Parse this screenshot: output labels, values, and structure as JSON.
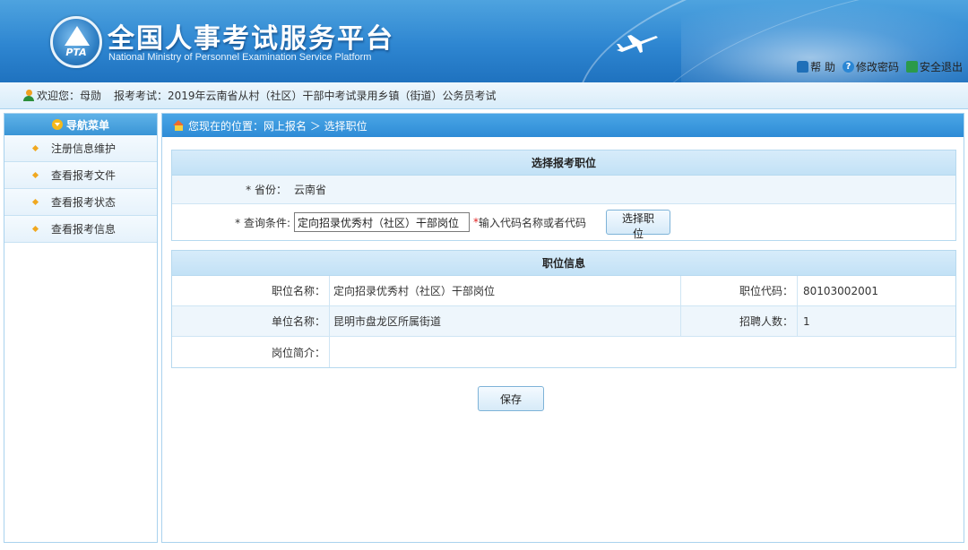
{
  "header": {
    "title": "全国人事考试服务平台",
    "subtitle": "National Ministry of Personnel Examination Service Platform",
    "emblem_text": "PTA",
    "links": [
      {
        "label": "帮 助",
        "icon": "lock-icon"
      },
      {
        "label": "修改密码",
        "icon": "help-icon"
      },
      {
        "label": "安全退出",
        "icon": "exit-icon"
      }
    ]
  },
  "welcome": {
    "greeting": "欢迎您：母勋",
    "exam": "报考考试：2019年云南省从村（社区）干部中考试录用乡镇（街道）公务员考试"
  },
  "sidebar": {
    "header": "导航菜单",
    "items": [
      {
        "label": "注册信息维护"
      },
      {
        "label": "查看报考文件"
      },
      {
        "label": "查看报考状态"
      },
      {
        "label": "查看报考信息"
      }
    ]
  },
  "breadcrumb": "您现在的位置：网上报名 ＞ 选择职位",
  "select_panel": {
    "title": "选择报考职位",
    "province_label": "* 省份：",
    "province_value": "云南省",
    "query_label": "* 查询条件:",
    "query_value": "定向招录优秀村（社区）干部岗位",
    "query_hint_star": "*",
    "query_hint": "输入代码名称或者代码",
    "select_button": "选择职位"
  },
  "info_panel": {
    "title": "职位信息",
    "position_name_label": "职位名称：",
    "position_name": "定向招录优秀村（社区）干部岗位",
    "position_code_label": "职位代码：",
    "position_code": "80103002001",
    "unit_label": "单位名称：",
    "unit_name": "昆明市盘龙区所属街道",
    "hire_count_label": "招聘人数：",
    "hire_count": "1",
    "intro_label": "岗位简介：",
    "intro": ""
  },
  "save_button": "保存",
  "colors": {
    "header_blue": "#2e86d1",
    "light_blue_bg": "#d8ecf9",
    "border_blue": "#a9d2ee",
    "required_red": "#e02020"
  }
}
